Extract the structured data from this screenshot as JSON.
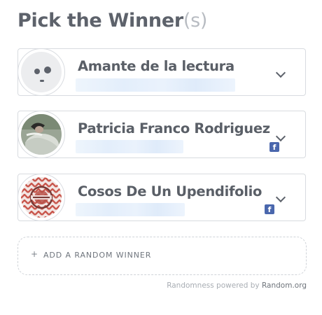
{
  "title": {
    "main": "Pick the Winner",
    "suffix": "(s)"
  },
  "winners": [
    {
      "name": "Amante de la lectura",
      "avatar": "placeholder-face-icon",
      "social": ""
    },
    {
      "name": "Patricia Franco Rodriguez",
      "avatar": "patricia-photo",
      "social": "facebook-icon"
    },
    {
      "name": "Cosos De Un Upendifolio",
      "avatar": "cosos-logo",
      "social": "facebook-icon"
    }
  ],
  "add_winner": {
    "plus": "+",
    "label": "ADD A RANDOM WINNER"
  },
  "footer": {
    "prefix": "Randomness powered by ",
    "link": "Random.org"
  },
  "colors": {
    "facebook": "#4a67ad",
    "text": "#5a5f67",
    "border": "#d8dbe0"
  }
}
